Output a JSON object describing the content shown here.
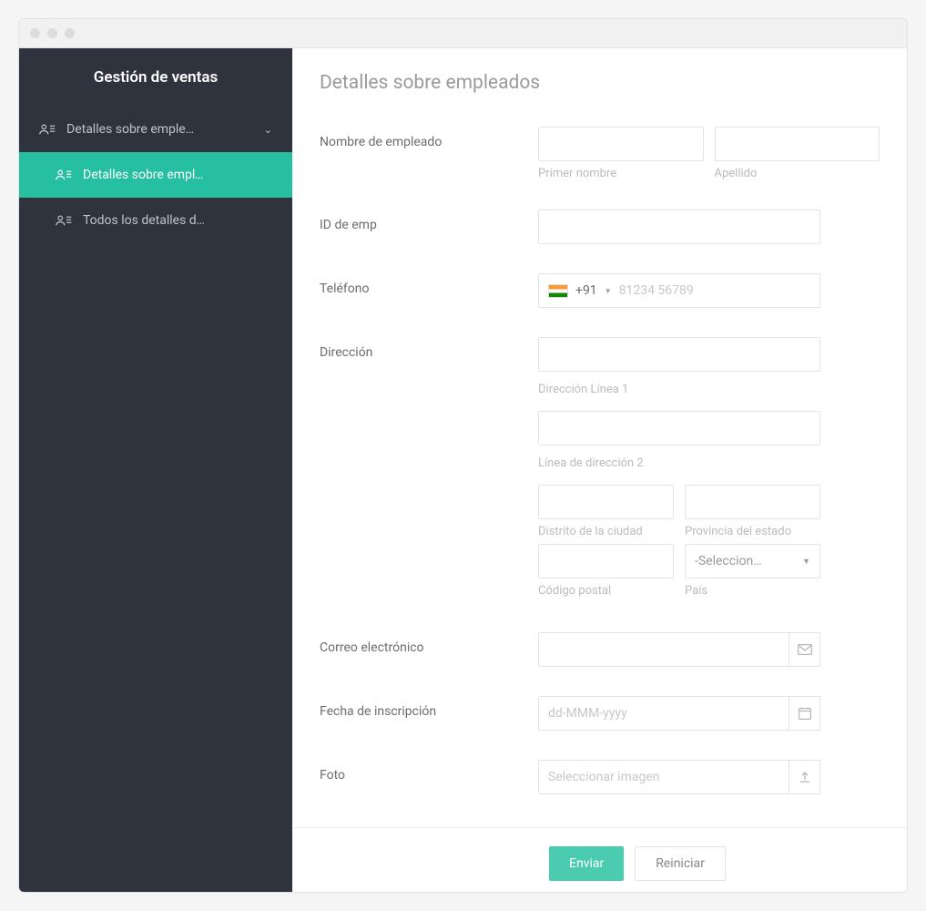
{
  "sidebar": {
    "title": "Gestión de ventas",
    "items": [
      {
        "label": "Detalles sobre emple…",
        "expanded": true
      },
      {
        "label": "Detalles sobre empl…",
        "active": true
      },
      {
        "label": "Todos los detalles d…"
      }
    ]
  },
  "page": {
    "title": "Detalles sobre empleados"
  },
  "form": {
    "name": {
      "label": "Nombre de empleado",
      "first_value": "",
      "first_sub": "Primer nombre",
      "last_value": "",
      "last_sub": "Apellido"
    },
    "emp_id": {
      "label": "ID de emp",
      "value": ""
    },
    "phone": {
      "label": "Teléfono",
      "country_code": "+91",
      "placeholder": "81234 56789",
      "value": ""
    },
    "address": {
      "label": "Dirección",
      "line1_value": "",
      "line1_sub": "Dirección Línea 1",
      "line2_value": "",
      "line2_sub": "Línea de dirección 2",
      "city_value": "",
      "city_sub": "Distrito de la ciudad",
      "state_value": "",
      "state_sub": "Provincia del estado",
      "postal_value": "",
      "postal_sub": "Código postal",
      "country_placeholder": "-Seleccion…",
      "country_sub": "País"
    },
    "email": {
      "label": "Correo electrónico",
      "value": ""
    },
    "date": {
      "label": "Fecha de inscripción",
      "placeholder": "dd-MMM-yyyy",
      "value": ""
    },
    "photo": {
      "label": "Foto",
      "placeholder": "Seleccionar imagen"
    }
  },
  "footer": {
    "submit": "Enviar",
    "reset": "Reiniciar"
  }
}
